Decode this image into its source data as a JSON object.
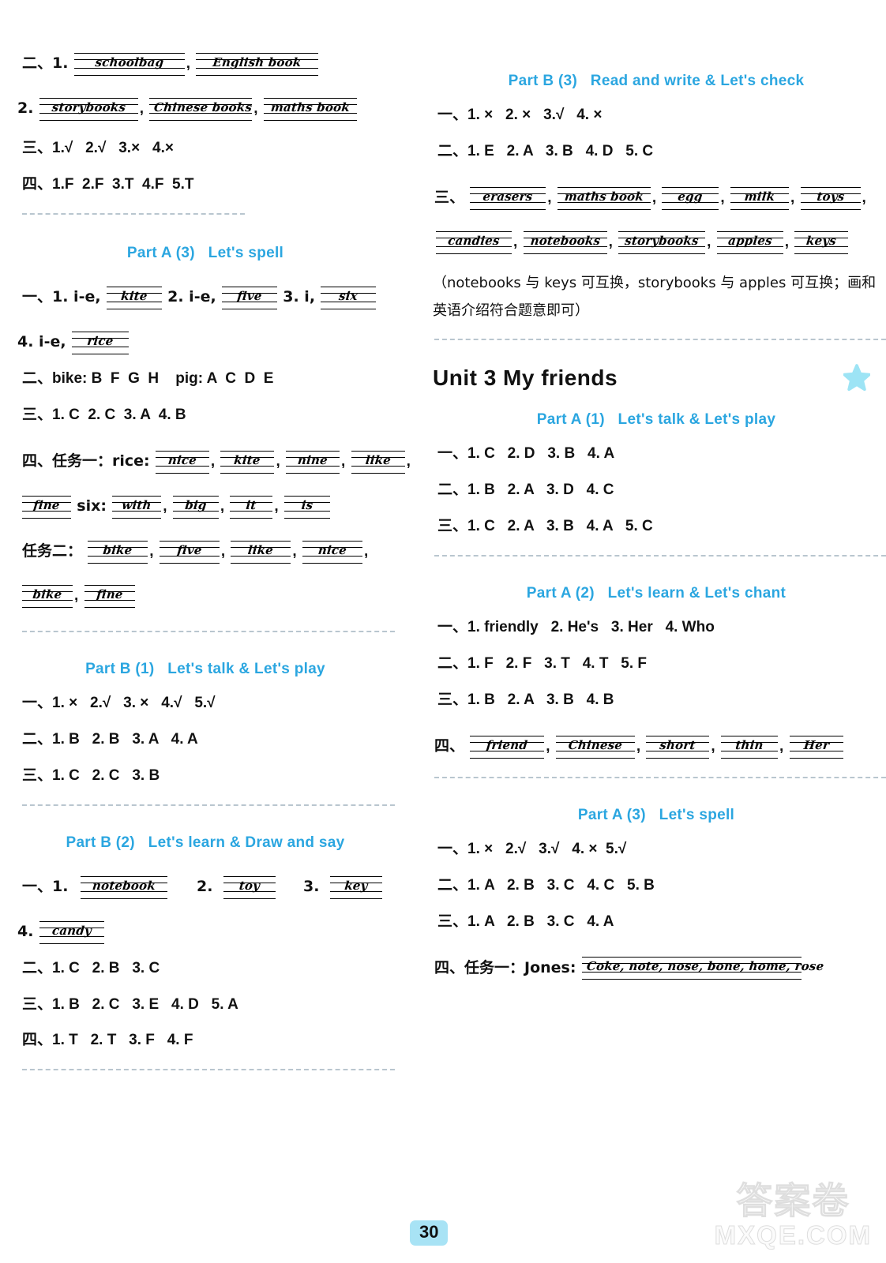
{
  "colors": {
    "heading": "#2BA6E0",
    "star": "#9DE4F5",
    "pageno_bg": "#A8E3F5",
    "separator": "#b9c6cf"
  },
  "page_number": "30",
  "watermark": {
    "cn": "答案卷",
    "domain": "MXQE.COM"
  },
  "left_column": {
    "top_answers": {
      "row1_label": "二、1.",
      "row1_words": [
        "schoolbag",
        "English book"
      ],
      "row2_label": "2.",
      "row2_words": [
        "storybooks",
        "Chinese books",
        "maths book"
      ],
      "row3": "三、1.√   2.√   3.×   4.×",
      "row4": "四、1.F  2.F  3.T  4.F  5.T"
    },
    "sections": [
      {
        "heading": "Part A (3)   Let's spell",
        "rows": [
          {
            "type": "mixed",
            "label": "一、1. i-e,",
            "segments": [
              "kite"
            ],
            "tail": "  2. i-e,",
            "tail_words": [
              "five"
            ],
            "tail2": "  3. i,",
            "tail2_words": [
              "six"
            ]
          },
          {
            "type": "mixed2",
            "label": "4. i-e,",
            "segments": [
              "rice"
            ]
          },
          {
            "type": "text",
            "value": "二、bike: B  F  G  H    pig: A  C  D  E"
          },
          {
            "type": "text",
            "value": "三、1. C  2. C  3. A  4. B"
          },
          {
            "type": "task1",
            "label": "四、任务一：rice:",
            "words": [
              "nice",
              "kite",
              "nine",
              "like"
            ]
          },
          {
            "type": "task1b",
            "words_first": [
              "fine"
            ],
            "mid": "six:",
            "words": [
              "with",
              "big",
              "it",
              "is"
            ]
          },
          {
            "type": "task2",
            "label": "任务二：",
            "words": [
              "bike",
              "five",
              "like",
              "nice"
            ]
          },
          {
            "type": "task2b",
            "words": [
              "bike",
              "fine"
            ]
          }
        ]
      },
      {
        "heading": "Part B (1)   Let's talk & Let's play",
        "rows": [
          {
            "type": "text",
            "value": "一、1. ×   2.√   3. ×   4.√   5.√"
          },
          {
            "type": "text",
            "value": "二、1. B   2. B   3. A   4. A"
          },
          {
            "type": "text",
            "value": "三、1. C   2. C   3. B"
          }
        ]
      },
      {
        "heading": "Part B (2)   Let's learn & Draw and say",
        "rows": [
          {
            "type": "lab3",
            "label": "一、1.",
            "w1": "notebook",
            "l2": "2.",
            "w2": "toy",
            "l3": "3.",
            "w3": "key"
          },
          {
            "type": "lab1",
            "label": "4.",
            "w1": "candy"
          },
          {
            "type": "text",
            "value": "二、1. C   2. B   3. C"
          },
          {
            "type": "text",
            "value": "三、1. B   2. C   3. E   4. D   5. A"
          },
          {
            "type": "text",
            "value": "四、1. T   2. T   3. F   4. F"
          }
        ]
      }
    ]
  },
  "right_column": {
    "sections": [
      {
        "heading": "Part B (3)   Read and write & Let's check",
        "rows": [
          {
            "type": "text",
            "value": "一、1. ×   2. ×   3.√   4. ×"
          },
          {
            "type": "text",
            "value": "二、1. E   2. A   3. B   4. D   5. C"
          },
          {
            "type": "hw_line",
            "label": "三、",
            "words": [
              "erasers",
              "maths book",
              "egg",
              "milk",
              "toys"
            ]
          },
          {
            "type": "hw_line2",
            "words": [
              "candies",
              "notebooks",
              "storybooks",
              "apples",
              "keys"
            ]
          }
        ],
        "note": "（notebooks 与 keys 可互换，storybooks 与 apples 可互换；画和英语介绍符合题意即可）"
      }
    ],
    "unit": {
      "title": "Unit 3   My friends",
      "star_icon": "star-icon"
    },
    "unit_sections": [
      {
        "heading": "Part A (1)   Let's talk & Let's play",
        "rows": [
          {
            "type": "text",
            "value": "一、1. C   2. D   3. B   4. A"
          },
          {
            "type": "text",
            "value": "二、1. B   2. A   3. D   4. C"
          },
          {
            "type": "text",
            "value": "三、1. C   2. A   3. B   4. A   5. C"
          }
        ]
      },
      {
        "heading": "Part A (2)   Let's learn & Let's chant",
        "rows": [
          {
            "type": "text",
            "value": "一、1. friendly   2. He's   3. Her   4. Who"
          },
          {
            "type": "text",
            "value": "二、1. F   2. F   3. T   4. T   5. F"
          },
          {
            "type": "text",
            "value": "三、1. B   2. A   3. B   4. B"
          },
          {
            "type": "hw_line",
            "label": "四、",
            "words": [
              "friend",
              "Chinese",
              "short",
              "thin",
              "Her"
            ]
          }
        ]
      },
      {
        "heading": "Part A (3)   Let's spell",
        "rows": [
          {
            "type": "text",
            "value": "一、1. ×   2.√   3.√   4. ×  5.√"
          },
          {
            "type": "text",
            "value": "二、1. A   2. B   3. C   4. C   5. B"
          },
          {
            "type": "text",
            "value": "三、1. A   2. B   3. C   4. A"
          },
          {
            "type": "hw_task",
            "label": "四、任务一：Jones:",
            "word": "Coke, note, nose, bone, home, rose"
          }
        ]
      }
    ]
  }
}
